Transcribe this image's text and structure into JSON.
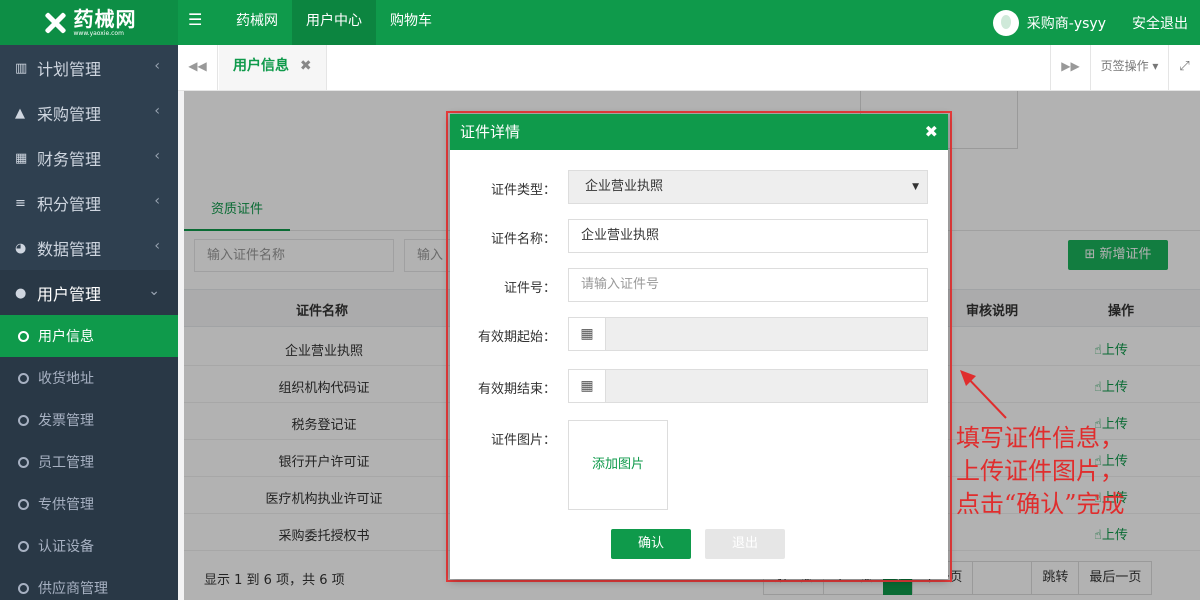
{
  "app": {
    "logo_text": "药械网",
    "logo_url": "www.yaoxie.com"
  },
  "topnav": {
    "items": [
      {
        "label": "药械网"
      },
      {
        "label": "用户中心"
      },
      {
        "label": "购物车"
      }
    ],
    "username": "采购商-ysyy",
    "logout_label": "安全退出"
  },
  "sidebar": {
    "items": [
      {
        "label": "计划管理",
        "icon": "bar-chart-icon"
      },
      {
        "label": "采购管理",
        "icon": "shopping-bag-icon"
      },
      {
        "label": "财务管理",
        "icon": "calculator-icon"
      },
      {
        "label": "积分管理",
        "icon": "database-icon"
      },
      {
        "label": "数据管理",
        "icon": "pie-chart-icon"
      },
      {
        "label": "用户管理",
        "icon": "user-icon"
      }
    ],
    "subitems": [
      {
        "label": "用户信息"
      },
      {
        "label": "收货地址"
      },
      {
        "label": "发票管理"
      },
      {
        "label": "员工管理"
      },
      {
        "label": "专供管理"
      },
      {
        "label": "认证设备"
      },
      {
        "label": "供应商管理"
      }
    ]
  },
  "tabbar": {
    "active_tab": "用户信息",
    "ops_label": "页签操作"
  },
  "main": {
    "sub_tab": "资质证件",
    "filter_name_placeholder": "输入证件名称",
    "filter2_placeholder": "输入",
    "add_button": "新增证件",
    "columns": {
      "name": "证件名称",
      "review": "审核说明",
      "action": "操作"
    },
    "rows": [
      {
        "name": "企业营业执照",
        "op": "上传"
      },
      {
        "name": "组织机构代码证",
        "op": "上传"
      },
      {
        "name": "税务登记证",
        "op": "上传"
      },
      {
        "name": "银行开户许可证",
        "op": "上传"
      },
      {
        "name": "医疗机构执业许可证",
        "op": "上传"
      },
      {
        "name": "采购委托授权书",
        "op": "上传"
      }
    ],
    "footer_info": "显示 1 到 6 项，共 6 项",
    "pager": {
      "first": "第一页",
      "prev": "上一页",
      "current": "1",
      "next": "下一页",
      "jump": "跳转",
      "last": "最后一页"
    }
  },
  "modal": {
    "title": "证件详情",
    "fields": {
      "type_label": "证件类型：",
      "type_value": "企业营业执照",
      "name_label": "证件名称：",
      "name_value": "企业营业执照",
      "number_label": "证件号：",
      "number_placeholder": "请输入证件号",
      "start_label": "有效期起始：",
      "end_label": "有效期结束：",
      "image_label": "证件图片：",
      "upload_label": "添加图片"
    },
    "confirm_label": "确认",
    "exit_label": "退出"
  },
  "annotation": {
    "line1": "填写证件信息，",
    "line2": "上传证件图片，",
    "line3": "点击“确认”完成"
  }
}
